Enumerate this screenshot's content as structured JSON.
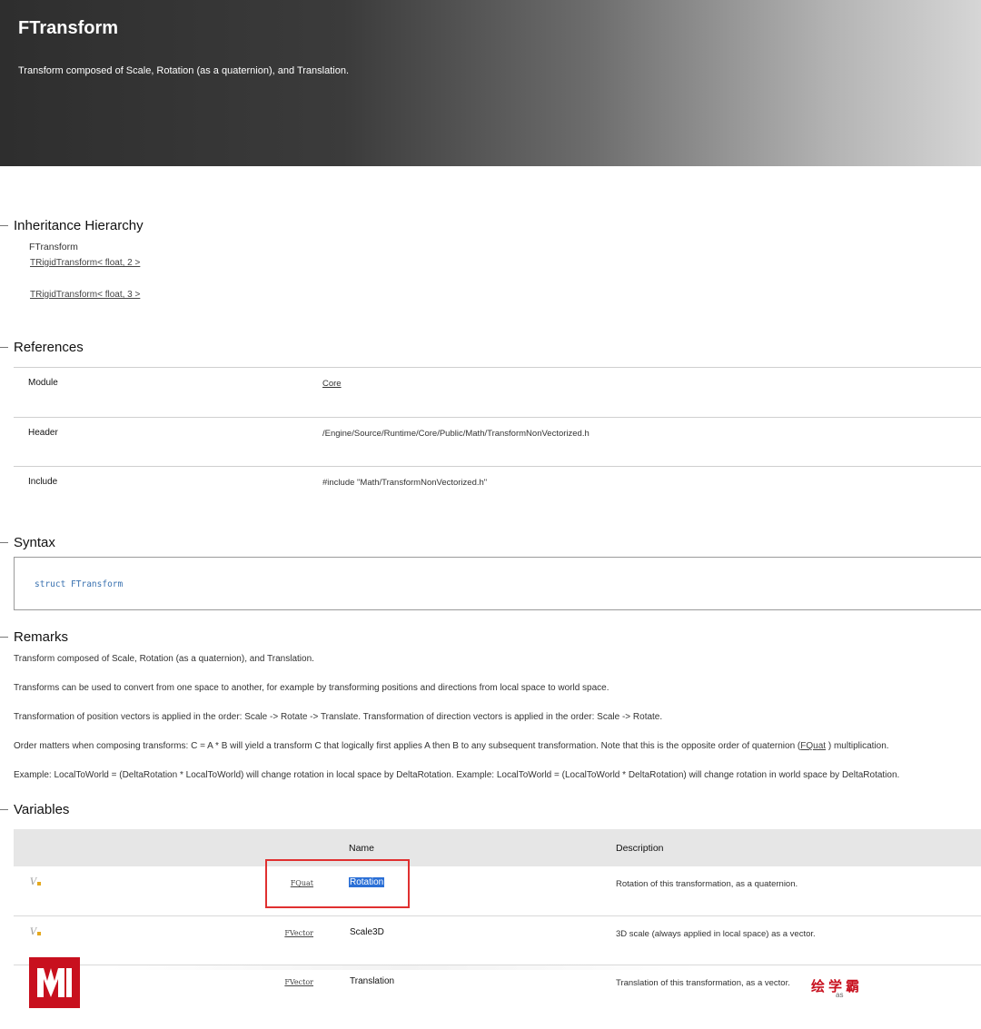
{
  "hero": {
    "title": "FTransform",
    "description": "Transform composed of Scale, Rotation (as a quaternion), and Translation."
  },
  "sections": {
    "inheritance": "Inheritance Hierarchy",
    "references": "References",
    "syntax": "Syntax",
    "remarks": "Remarks",
    "variables": "Variables"
  },
  "inheritance": {
    "root": "FTransform",
    "children": [
      "TRigidTransform< float, 2 >",
      "TRigidTransform< float, 3 >"
    ]
  },
  "references": [
    {
      "key": "Module",
      "value": "Core",
      "is_link": true
    },
    {
      "key": "Header",
      "value": "/Engine/Source/Runtime/Core/Public/Math/TransformNonVectorized.h",
      "is_link": false
    },
    {
      "key": "Include",
      "value": "#include \"Math/TransformNonVectorized.h\"",
      "is_link": false
    }
  ],
  "syntax": {
    "code": "struct FTransform"
  },
  "remarks": {
    "p1": "Transform composed of Scale, Rotation (as a quaternion), and Translation.",
    "p2": "Transforms can be used to convert from one space to another, for example by transforming positions and directions from local space to world space.",
    "p3": "Transformation of position vectors is applied in the order: Scale -> Rotate -> Translate. Transformation of direction vectors is applied in the order: Scale -> Rotate.",
    "p4_before": "Order matters when composing transforms: C = A * B will yield a transform C that logically first applies A then B to any subsequent transformation. Note that this is the opposite order of quaternion (",
    "p4_link": "FQuat",
    "p4_after": " ) multiplication.",
    "p5": "Example: LocalToWorld = (DeltaRotation * LocalToWorld) will change rotation in local space by DeltaRotation. Example: LocalToWorld = (LocalToWorld * DeltaRotation) will change rotation in world space by DeltaRotation."
  },
  "variables": {
    "headers": {
      "name": "Name",
      "description": "Description"
    },
    "rows": [
      {
        "icon": "V",
        "type": "FQuat",
        "name": "Rotation",
        "description": "Rotation of this transformation, as a quaternion.",
        "selected": true
      },
      {
        "icon": "V",
        "type": "FVector",
        "name": "Scale3D",
        "description": "3D scale (always applied in local space) as a vector.",
        "selected": false
      },
      {
        "icon": "",
        "type": "FVector",
        "name": "Translation",
        "description": "Translation of this transformation, as a vector.",
        "selected": false
      }
    ]
  },
  "watermark": {
    "text": "绘学霸",
    "sub": "as"
  },
  "colors": {
    "highlight_border": "#e03030",
    "selection": "#2a6fd6",
    "logo": "#c8101e",
    "code": "#3a72b0"
  }
}
